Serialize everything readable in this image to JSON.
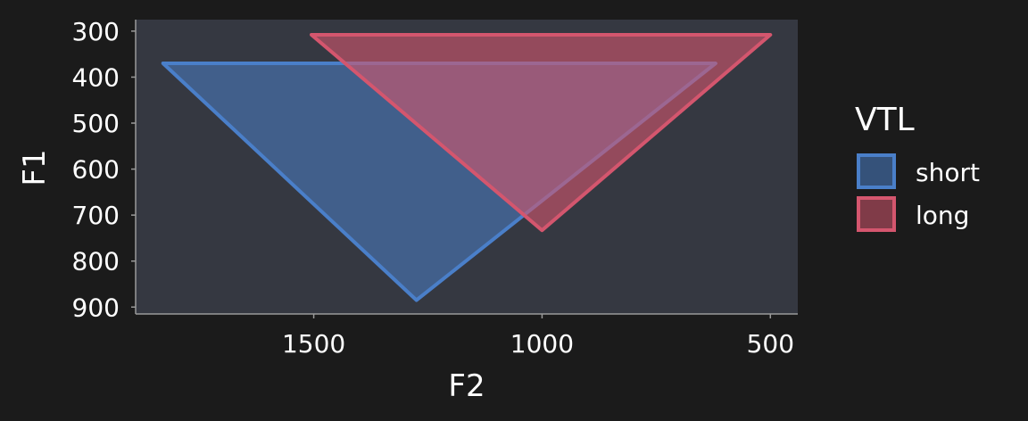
{
  "chart_data": {
    "type": "area",
    "title": "",
    "xlabel": "F2",
    "ylabel": "F1",
    "x_reversed": true,
    "y_reversed": true,
    "xlim": [
      1890,
      440
    ],
    "ylim": [
      275,
      915
    ],
    "x_ticks": [
      1500,
      1000,
      500
    ],
    "y_ticks": [
      300,
      400,
      500,
      600,
      700,
      800,
      900
    ],
    "grid": false,
    "legend": {
      "title": "VTL",
      "position": "right"
    },
    "series": [
      {
        "name": "short",
        "color": "#4a7fc9",
        "points": [
          {
            "x": 1830,
            "y": 370
          },
          {
            "x": 1275,
            "y": 885
          },
          {
            "x": 620,
            "y": 370
          }
        ]
      },
      {
        "name": "long",
        "color": "#d4566e",
        "points": [
          {
            "x": 1505,
            "y": 308
          },
          {
            "x": 1000,
            "y": 733
          },
          {
            "x": 500,
            "y": 308
          }
        ]
      }
    ]
  }
}
